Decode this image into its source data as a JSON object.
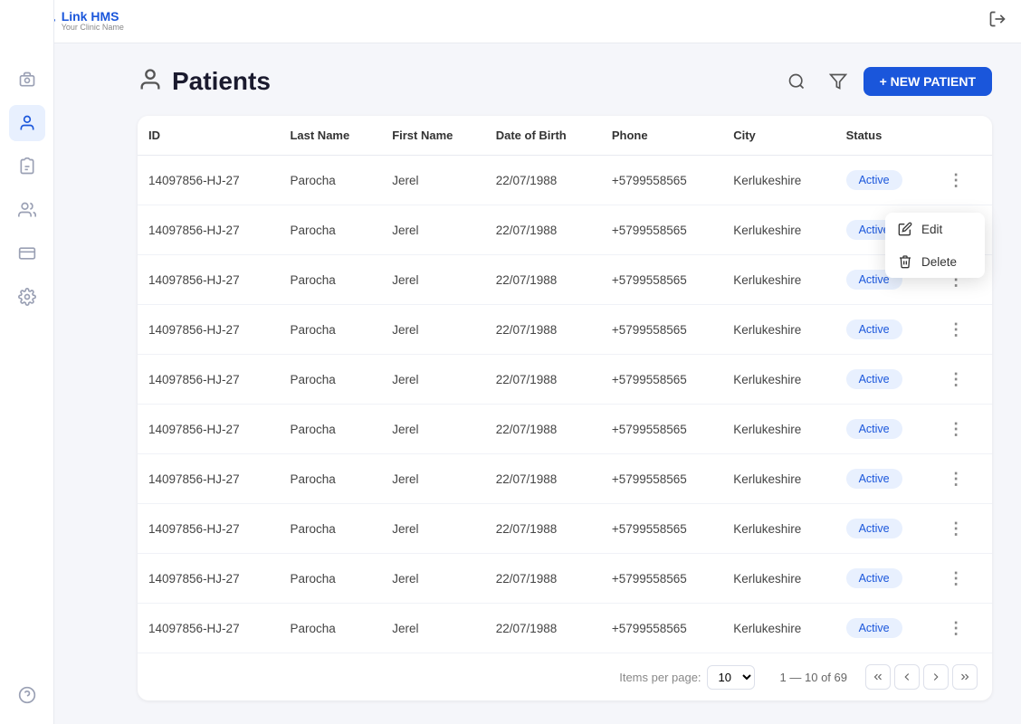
{
  "app": {
    "name": "Link HMS",
    "tagline": "Your Clinic Name",
    "logo_symbol": "+"
  },
  "topbar": {
    "logout_icon": "logout"
  },
  "sidebar": {
    "items": [
      {
        "id": "camera",
        "label": "Camera / Capture",
        "active": false
      },
      {
        "id": "patients",
        "label": "Patients",
        "active": true
      },
      {
        "id": "lab",
        "label": "Lab",
        "active": false
      },
      {
        "id": "group",
        "label": "Group",
        "active": false
      },
      {
        "id": "billing",
        "label": "Billing",
        "active": false
      },
      {
        "id": "settings",
        "label": "Settings",
        "active": false
      },
      {
        "id": "help",
        "label": "Help",
        "active": false
      }
    ]
  },
  "page": {
    "title": "Patients",
    "new_patient_label": "+ NEW PATIENT",
    "search_icon": "search",
    "filter_icon": "filter"
  },
  "table": {
    "columns": [
      "ID",
      "Last Name",
      "First Name",
      "Date of Birth",
      "Phone",
      "City",
      "Status"
    ],
    "rows": [
      {
        "id": "14097856-HJ-27",
        "last_name": "Parocha",
        "first_name": "Jerel",
        "dob": "22/07/1988",
        "phone": "+5799558565",
        "city": "Kerlukeshire",
        "status": "Active"
      },
      {
        "id": "14097856-HJ-27",
        "last_name": "Parocha",
        "first_name": "Jerel",
        "dob": "22/07/1988",
        "phone": "+5799558565",
        "city": "Kerlukeshire",
        "status": "Active"
      },
      {
        "id": "14097856-HJ-27",
        "last_name": "Parocha",
        "first_name": "Jerel",
        "dob": "22/07/1988",
        "phone": "+5799558565",
        "city": "Kerlukeshire",
        "status": "Active"
      },
      {
        "id": "14097856-HJ-27",
        "last_name": "Parocha",
        "first_name": "Jerel",
        "dob": "22/07/1988",
        "phone": "+5799558565",
        "city": "Kerlukeshire",
        "status": "Active"
      },
      {
        "id": "14097856-HJ-27",
        "last_name": "Parocha",
        "first_name": "Jerel",
        "dob": "22/07/1988",
        "phone": "+5799558565",
        "city": "Kerlukeshire",
        "status": "Active"
      },
      {
        "id": "14097856-HJ-27",
        "last_name": "Parocha",
        "first_name": "Jerel",
        "dob": "22/07/1988",
        "phone": "+5799558565",
        "city": "Kerlukeshire",
        "status": "Active"
      },
      {
        "id": "14097856-HJ-27",
        "last_name": "Parocha",
        "first_name": "Jerel",
        "dob": "22/07/1988",
        "phone": "+5799558565",
        "city": "Kerlukeshire",
        "status": "Active"
      },
      {
        "id": "14097856-HJ-27",
        "last_name": "Parocha",
        "first_name": "Jerel",
        "dob": "22/07/1988",
        "phone": "+5799558565",
        "city": "Kerlukeshire",
        "status": "Active"
      },
      {
        "id": "14097856-HJ-27",
        "last_name": "Parocha",
        "first_name": "Jerel",
        "dob": "22/07/1988",
        "phone": "+5799558565",
        "city": "Kerlukeshire",
        "status": "Active"
      },
      {
        "id": "14097856-HJ-27",
        "last_name": "Parocha",
        "first_name": "Jerel",
        "dob": "22/07/1988",
        "phone": "+5799558565",
        "city": "Kerlukeshire",
        "status": "Active"
      }
    ]
  },
  "context_menu": {
    "edit_label": "Edit",
    "delete_label": "Delete"
  },
  "pagination": {
    "items_per_page_label": "Items per page:",
    "per_page_value": "10",
    "page_info": "1 — 10 of 69"
  }
}
